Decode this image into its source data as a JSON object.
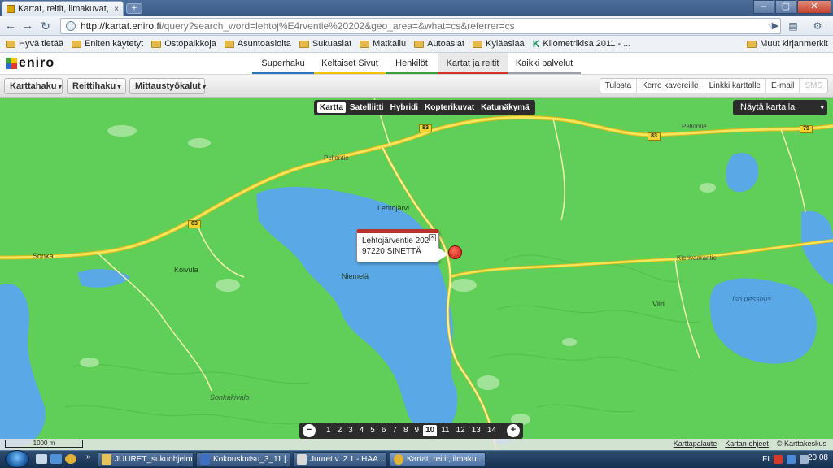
{
  "browser": {
    "tab_title": "Kartat, reitit, ilmakuvat, k...",
    "tab_close": "×",
    "new_tab": "+",
    "window_buttons": [
      "–",
      "▢",
      "✕"
    ],
    "url_host": "http://kartat.eniro.fi",
    "url_path": "/query?search_word=lehtoj%E4rventie%20202&geo_area=&what=cs&referrer=cs",
    "bookmarks": [
      "Hyvä tietää",
      "Eniten käytetyt",
      "Ostopaikkoja",
      "Asuntoasioita",
      "Sukuasiat",
      "Matkailu",
      "Autoasiat",
      "Kyläasiaa",
      "Kilometrikisa 2011 - ..."
    ],
    "bookmarks_other": "Muut kirjanmerkit"
  },
  "site": {
    "logo": "eniro",
    "nav_tabs": [
      {
        "label": "Superhaku",
        "color": "#2c72c7"
      },
      {
        "label": "Keltaiset Sivut",
        "color": "#f1c400"
      },
      {
        "label": "Henkilöt",
        "color": "#3aa043"
      },
      {
        "label": "Kartat ja reitit",
        "color": "#d0342c"
      },
      {
        "label": "Kaikki palvelut",
        "color": "#9aa0a8"
      }
    ],
    "active_tab": "Kartat ja reitit"
  },
  "mapbar": {
    "karttahaku": "Karttahaku",
    "reittihaku": "Reittihaku",
    "mittaus": "Mittaustyökalut",
    "right_buttons": [
      "Tulosta",
      "Kerro kavereille",
      "Linkki karttalle",
      "E-mail",
      "SMS"
    ]
  },
  "map": {
    "types": [
      "Kartta",
      "Satelliitti",
      "Hybridi",
      "Kopterikuvat",
      "Katunäkymä"
    ],
    "active_type": "Kartta",
    "show_on_map": "Näytä kartalla",
    "popup_line1": "Lehtojärventie 202",
    "popup_line2": "97220 SINETTÄ",
    "popup_close": "×",
    "places": [
      "Lehtojärvi",
      "Sonka",
      "Koivula",
      "Niemelä",
      "Viiri",
      "Iso pessous",
      "Sonkakivalo"
    ],
    "road_labels": [
      "Pellontie",
      "Pellontie",
      "Pellontie",
      "Kierivaarantie"
    ],
    "road_numbers": [
      "83",
      "83",
      "83",
      "79"
    ],
    "zoom_out": "−",
    "zoom_in": "+",
    "zoom_levels": [
      "1",
      "2",
      "3",
      "4",
      "5",
      "6",
      "7",
      "8",
      "9",
      "10",
      "11",
      "12",
      "13",
      "14"
    ],
    "zoom_current": "10",
    "scale": "1000 m",
    "footer_links": [
      "Karttapalaute",
      "Kartan ohjeet",
      "© Karttakeskus"
    ],
    "colors": {
      "land": "#5fcf57",
      "water": "#5aa9e6",
      "road": "#f6e55a",
      "pin": "#d8180f"
    }
  },
  "taskbar": {
    "tasks": [
      "JUURET_sukuohjelma",
      "Kokouskutsu_3_11 [...",
      "Juuret  v. 2.1 - HAA...",
      "Kartat, reitit, ilmaku..."
    ],
    "active_task": "Kartat, reitit, ilmaku...",
    "tray_lang": "FI",
    "clock": "20:08"
  }
}
